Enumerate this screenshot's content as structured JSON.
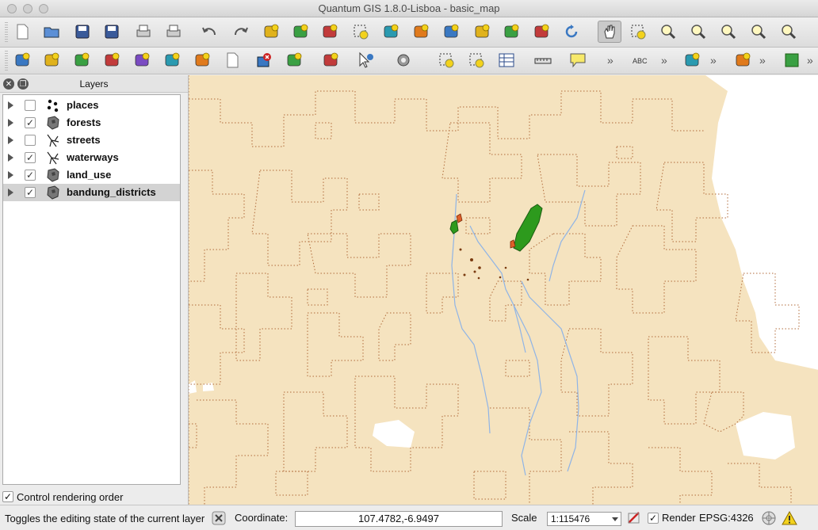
{
  "window": {
    "title": "Quantum GIS 1.8.0-Lisboa - basic_map"
  },
  "toolbar_row1": [
    {
      "name": "new-project-icon"
    },
    {
      "name": "open-project-icon"
    },
    {
      "name": "save-project-icon"
    },
    {
      "name": "save-as-icon"
    },
    {
      "name": "new-print-composer-icon"
    },
    {
      "name": "print-icon"
    },
    {
      "name": "undo-icon"
    },
    {
      "name": "redo-icon"
    },
    {
      "name": "add-feature-icon"
    },
    {
      "name": "move-feature-icon"
    },
    {
      "name": "node-tool-icon"
    },
    {
      "name": "delete-selected-icon"
    },
    {
      "name": "cut-features-icon"
    },
    {
      "name": "copy-features-icon"
    },
    {
      "name": "paste-features-icon"
    },
    {
      "name": "simplify-feature-icon"
    },
    {
      "name": "add-ring-icon"
    },
    {
      "name": "add-part-icon"
    },
    {
      "name": "refresh-icon"
    },
    {
      "name": "pan-icon"
    },
    {
      "name": "pan-to-selection-icon"
    },
    {
      "name": "zoom-in-icon"
    },
    {
      "name": "zoom-out-icon"
    },
    {
      "name": "zoom-actual-size-icon"
    },
    {
      "name": "zoom-full-icon"
    },
    {
      "name": "zoom-to-selection-icon"
    }
  ],
  "toolbar_row2": [
    {
      "name": "add-vector-layer-icon"
    },
    {
      "name": "add-raster-layer-icon"
    },
    {
      "name": "add-postgis-layer-icon"
    },
    {
      "name": "add-spatialite-layer-icon"
    },
    {
      "name": "add-mssql-layer-icon"
    },
    {
      "name": "add-wms-layer-icon"
    },
    {
      "name": "add-wcs-layer-icon"
    },
    {
      "name": "new-shapefile-icon"
    },
    {
      "name": "remove-layer-icon"
    },
    {
      "name": "add-delimited-text-icon"
    },
    {
      "name": "add-wfs-layer-icon"
    },
    {
      "name": "identify-icon"
    },
    {
      "name": "run-action-icon"
    },
    {
      "name": "select-features-icon"
    },
    {
      "name": "deselect-icon"
    },
    {
      "name": "attribute-table-icon"
    },
    {
      "name": "measure-line-icon"
    },
    {
      "name": "map-tips-icon"
    },
    {
      "name": "label-icon"
    },
    {
      "name": "add-feature-plugin-icon"
    },
    {
      "name": "digitize-icon"
    },
    {
      "name": "grass-icon"
    }
  ],
  "layers_panel": {
    "title": "Layers",
    "layers": [
      {
        "name": "places",
        "checked": false,
        "type": "point",
        "selected": false
      },
      {
        "name": "forests",
        "checked": true,
        "type": "polygon",
        "selected": false
      },
      {
        "name": "streets",
        "checked": false,
        "type": "line",
        "selected": false
      },
      {
        "name": "waterways",
        "checked": true,
        "type": "line",
        "selected": false
      },
      {
        "name": "land_use",
        "checked": true,
        "type": "polygon",
        "selected": false
      },
      {
        "name": "bandung_districts",
        "checked": true,
        "type": "polygon",
        "selected": true
      }
    ],
    "control_rendering_order_label": "Control rendering order",
    "control_rendering_order_checked": true
  },
  "map": {
    "background_color": "#f5e3bf",
    "district_outline_color": "#b06a3a",
    "forest_color": "#2d9a1d",
    "water_color": "#8fb4e6"
  },
  "statusbar": {
    "message": "Toggles the editing state of the current layer",
    "coordinate_label": "Coordinate:",
    "coordinate_value": "107.4782,-6.9497",
    "scale_label": "Scale",
    "scale_value": "1:115476",
    "render_label": "Render",
    "render_checked": true,
    "crs": "EPSG:4326"
  }
}
